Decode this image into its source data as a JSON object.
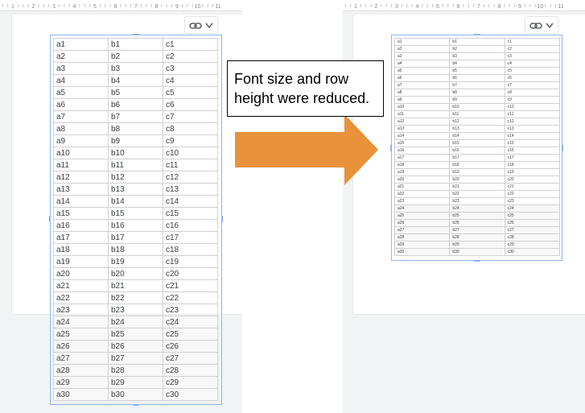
{
  "callout": {
    "line1": "Font size and row",
    "line2": "height were reduced."
  },
  "ruler": {
    "numbers": [
      "1",
      "2",
      "3",
      "4",
      "5",
      "6",
      "7",
      "8",
      "9",
      "10",
      "11"
    ]
  },
  "colors": {
    "arrow": "#e8923a",
    "selection": "#8ab4f8",
    "canvas": "#f1f3f4"
  },
  "icons": {
    "link": "link-icon",
    "dropdown": "chevron-down-icon"
  },
  "table": {
    "columns": [
      "a",
      "b",
      "c"
    ],
    "rows": [
      [
        "a1",
        "b1",
        "c1"
      ],
      [
        "a2",
        "b2",
        "c2"
      ],
      [
        "a3",
        "b3",
        "c3"
      ],
      [
        "a4",
        "b4",
        "c4"
      ],
      [
        "a5",
        "b5",
        "c5"
      ],
      [
        "a6",
        "b6",
        "c6"
      ],
      [
        "a7",
        "b7",
        "c7"
      ],
      [
        "a8",
        "b8",
        "c8"
      ],
      [
        "a9",
        "b9",
        "c9"
      ],
      [
        "a10",
        "b10",
        "c10"
      ],
      [
        "a11",
        "b11",
        "c11"
      ],
      [
        "a12",
        "b12",
        "c12"
      ],
      [
        "a13",
        "b13",
        "c13"
      ],
      [
        "a14",
        "b14",
        "c14"
      ],
      [
        "a15",
        "b15",
        "c15"
      ],
      [
        "a16",
        "b16",
        "c16"
      ],
      [
        "a17",
        "b17",
        "c17"
      ],
      [
        "a18",
        "b18",
        "c18"
      ],
      [
        "a19",
        "b19",
        "c19"
      ],
      [
        "a20",
        "b20",
        "c20"
      ],
      [
        "a21",
        "b21",
        "c21"
      ],
      [
        "a22",
        "b22",
        "c22"
      ],
      [
        "a23",
        "b23",
        "c23"
      ],
      [
        "a24",
        "b24",
        "c24"
      ],
      [
        "a25",
        "b25",
        "c25"
      ],
      [
        "a26",
        "b26",
        "c26"
      ],
      [
        "a27",
        "b27",
        "c27"
      ],
      [
        "a28",
        "b28",
        "c28"
      ],
      [
        "a29",
        "b29",
        "c29"
      ],
      [
        "a30",
        "b30",
        "c30"
      ]
    ]
  }
}
